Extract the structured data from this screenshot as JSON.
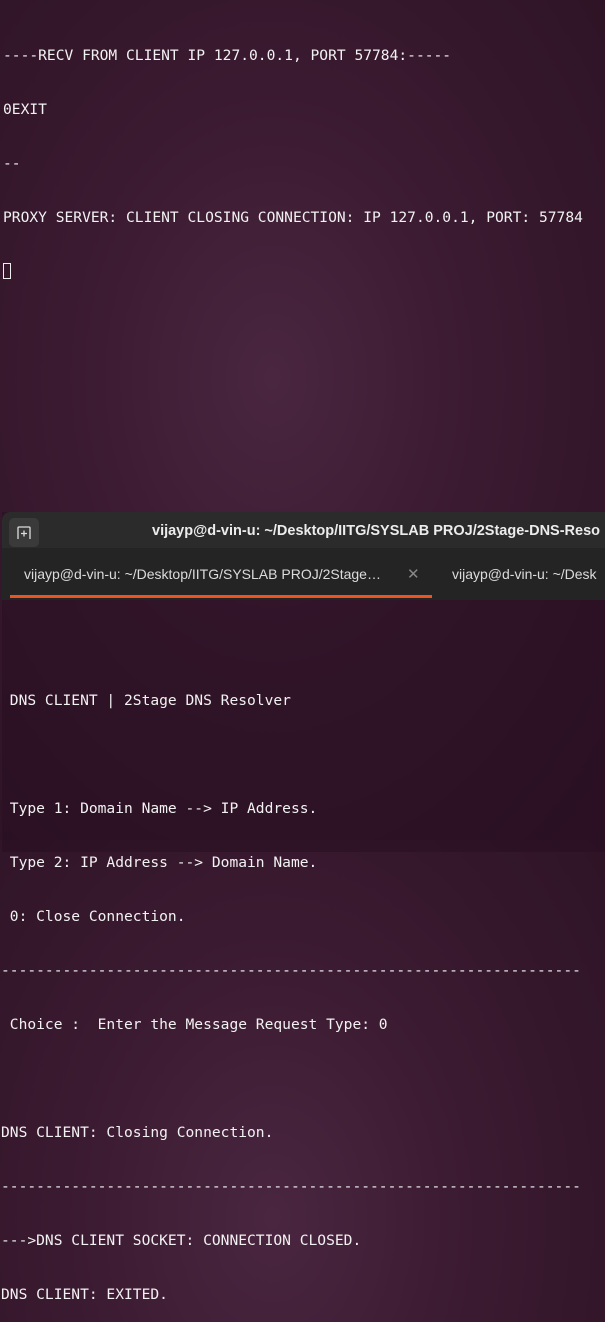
{
  "server_terminal": {
    "lines": [
      "----RECV FROM CLIENT IP 127.0.0.1, PORT 57784:-----",
      "0EXIT",
      "--",
      "PROXY SERVER: CLIENT CLOSING CONNECTION: IP 127.0.0.1, PORT: 57784"
    ]
  },
  "client_window": {
    "title": "vijayp@d-vin-u: ~/Desktop/IITG/SYSLAB PROJ/2Stage-DNS-Reso",
    "new_tab_icon": "new-tab-icon",
    "tabs": [
      {
        "label": "vijayp@d-vin-u: ~/Desktop/IITG/SYSLAB PROJ/2Stage…",
        "active": true
      },
      {
        "label": "vijayp@d-vin-u: ~/Desk",
        "active": false
      }
    ],
    "accent_color": "#e95420",
    "lines": [
      "",
      " DNS CLIENT | 2Stage DNS Resolver",
      "",
      " Type 1: Domain Name --> IP Address.",
      " Type 2: IP Address --> Domain Name.",
      " 0: Close Connection.",
      "------------------------------------------------------------------",
      " Choice :  Enter the Message Request Type: 0",
      "",
      "DNS CLIENT: Closing Connection.",
      "------------------------------------------------------------------",
      "--->DNS CLIENT SOCKET: CONNECTION CLOSED.",
      "DNS CLIENT: EXITED."
    ]
  }
}
